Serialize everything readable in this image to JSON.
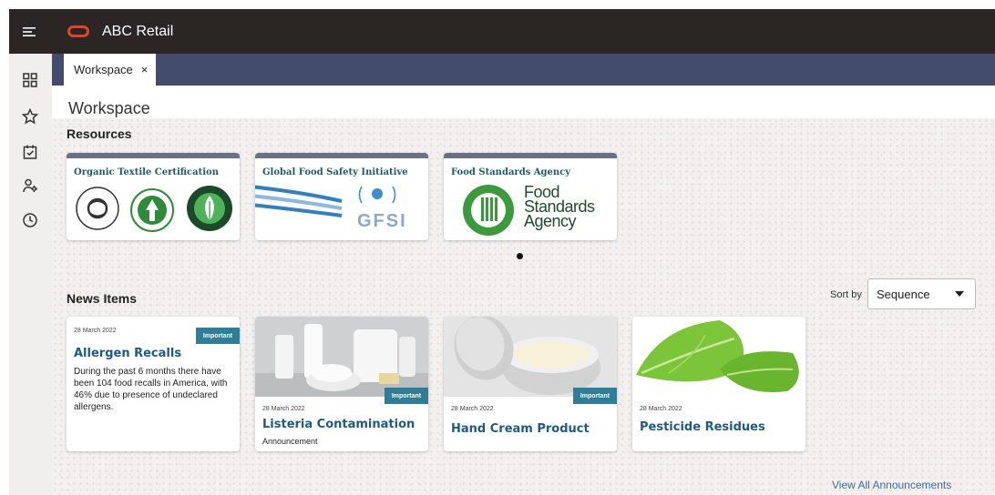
{
  "app": {
    "title": "ABC Retail"
  },
  "topbar": {
    "menu_icon": "hamburger-icon",
    "logo_icon": "oracle-logo-icon"
  },
  "sidebar": {
    "items": [
      {
        "icon": "grid-icon"
      },
      {
        "icon": "star-icon"
      },
      {
        "icon": "calendar-check-icon"
      },
      {
        "icon": "person-settings-icon"
      },
      {
        "icon": "clock-icon"
      }
    ]
  },
  "tabs": [
    {
      "label": "Workspace",
      "close": "×"
    }
  ],
  "workspace": {
    "title": "Workspace"
  },
  "resources": {
    "title": "Resources",
    "cards": [
      {
        "title": "Organic Textile Certification",
        "logo": "organic-certification-logos"
      },
      {
        "title": "Global Food Safety Initiative",
        "logo": "gfsi-logo",
        "logo_text": "GFSI"
      },
      {
        "title": "Food Standards Agency",
        "logo": "food-standards-agency-logo",
        "logo_text": [
          "Food",
          "Standards",
          "Agency"
        ]
      }
    ],
    "carousel_dots": 1
  },
  "news": {
    "title": "News Items",
    "sort_label": "Sort by",
    "sort_value": "Sequence",
    "items": [
      {
        "date": "28 March 2022",
        "badge": "Important",
        "title": "Allergen Recalls",
        "description": "During the past 6 months there have been 104 food recalls in America, with 46% due to presence of undeclared allergens.",
        "image": "none"
      },
      {
        "date": "28 March 2022",
        "badge": "Important",
        "title": "Listeria Contamination",
        "subtitle": "Announcement",
        "image": "dairy-products"
      },
      {
        "date": "28 March 2022",
        "badge": "Important",
        "title": "Hand Cream Product",
        "image": "cream-jar"
      },
      {
        "date": "28 March 2022",
        "title": "Pesticide Residues",
        "image": "lettuce"
      }
    ],
    "view_all": "View All Announcements"
  },
  "colors": {
    "topbar": "#2b2623",
    "tabstrip": "#444c6e",
    "accent": "#2f7d96",
    "logo": "#e0442c",
    "link": "#3c6e9c"
  }
}
